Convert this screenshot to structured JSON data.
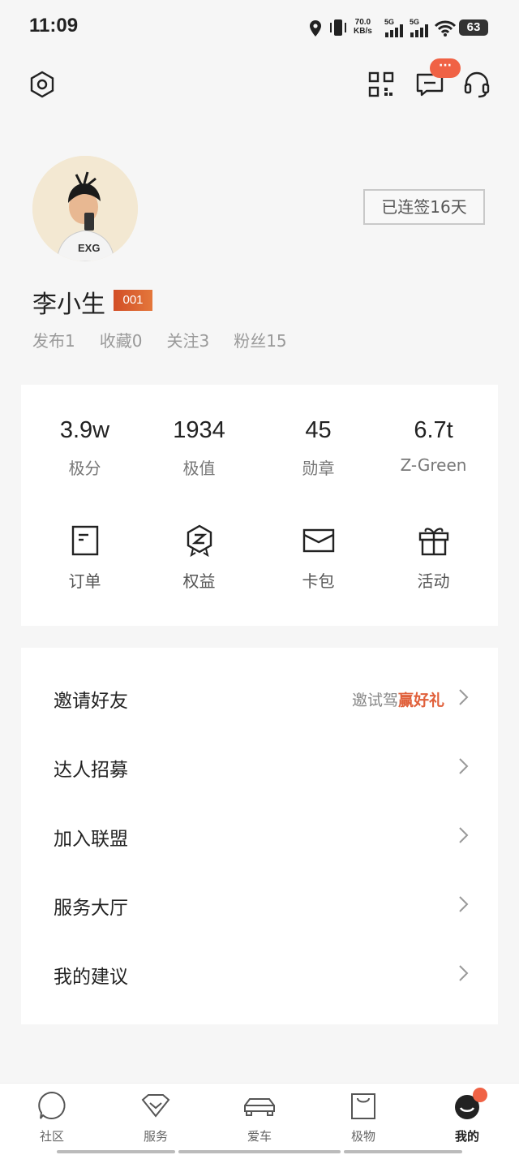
{
  "status": {
    "time": "11:09",
    "net_speed_value": "70.0",
    "net_speed_unit": "KB/s",
    "sim1": "5G",
    "sim2": "5G",
    "battery": "63"
  },
  "header": {
    "badge": "···"
  },
  "profile": {
    "name": "李小生",
    "level": "001",
    "checkin": "已连签16天",
    "stats": [
      {
        "label": "发布1"
      },
      {
        "label": "收藏0"
      },
      {
        "label": "关注3"
      },
      {
        "label": "粉丝15"
      }
    ]
  },
  "metrics": [
    {
      "value": "3.9w",
      "label": "极分"
    },
    {
      "value": "1934",
      "label": "极值"
    },
    {
      "value": "45",
      "label": "勋章"
    },
    {
      "value": "6.7t",
      "label": "Z-Green"
    }
  ],
  "quick_actions": [
    {
      "label": "订单",
      "icon": "order-icon"
    },
    {
      "label": "权益",
      "icon": "benefits-icon"
    },
    {
      "label": "卡包",
      "icon": "wallet-icon"
    },
    {
      "label": "活动",
      "icon": "gift-icon"
    }
  ],
  "menu": [
    {
      "label": "邀请好友",
      "promo_prefix": "邀试驾",
      "promo_highlight": "赢好礼"
    },
    {
      "label": "达人招募"
    },
    {
      "label": "加入联盟"
    },
    {
      "label": "服务大厅"
    },
    {
      "label": "我的建议"
    }
  ],
  "nav": [
    {
      "label": "社区",
      "icon": "community-icon"
    },
    {
      "label": "服务",
      "icon": "service-icon"
    },
    {
      "label": "爱车",
      "icon": "car-icon"
    },
    {
      "label": "极物",
      "icon": "shop-bag-icon"
    },
    {
      "label": "我的",
      "icon": "profile-icon"
    }
  ],
  "colors": {
    "accent": "#e0603b",
    "badge": "#f06245",
    "level_start": "#d24e26",
    "level_end": "#e4773b"
  }
}
